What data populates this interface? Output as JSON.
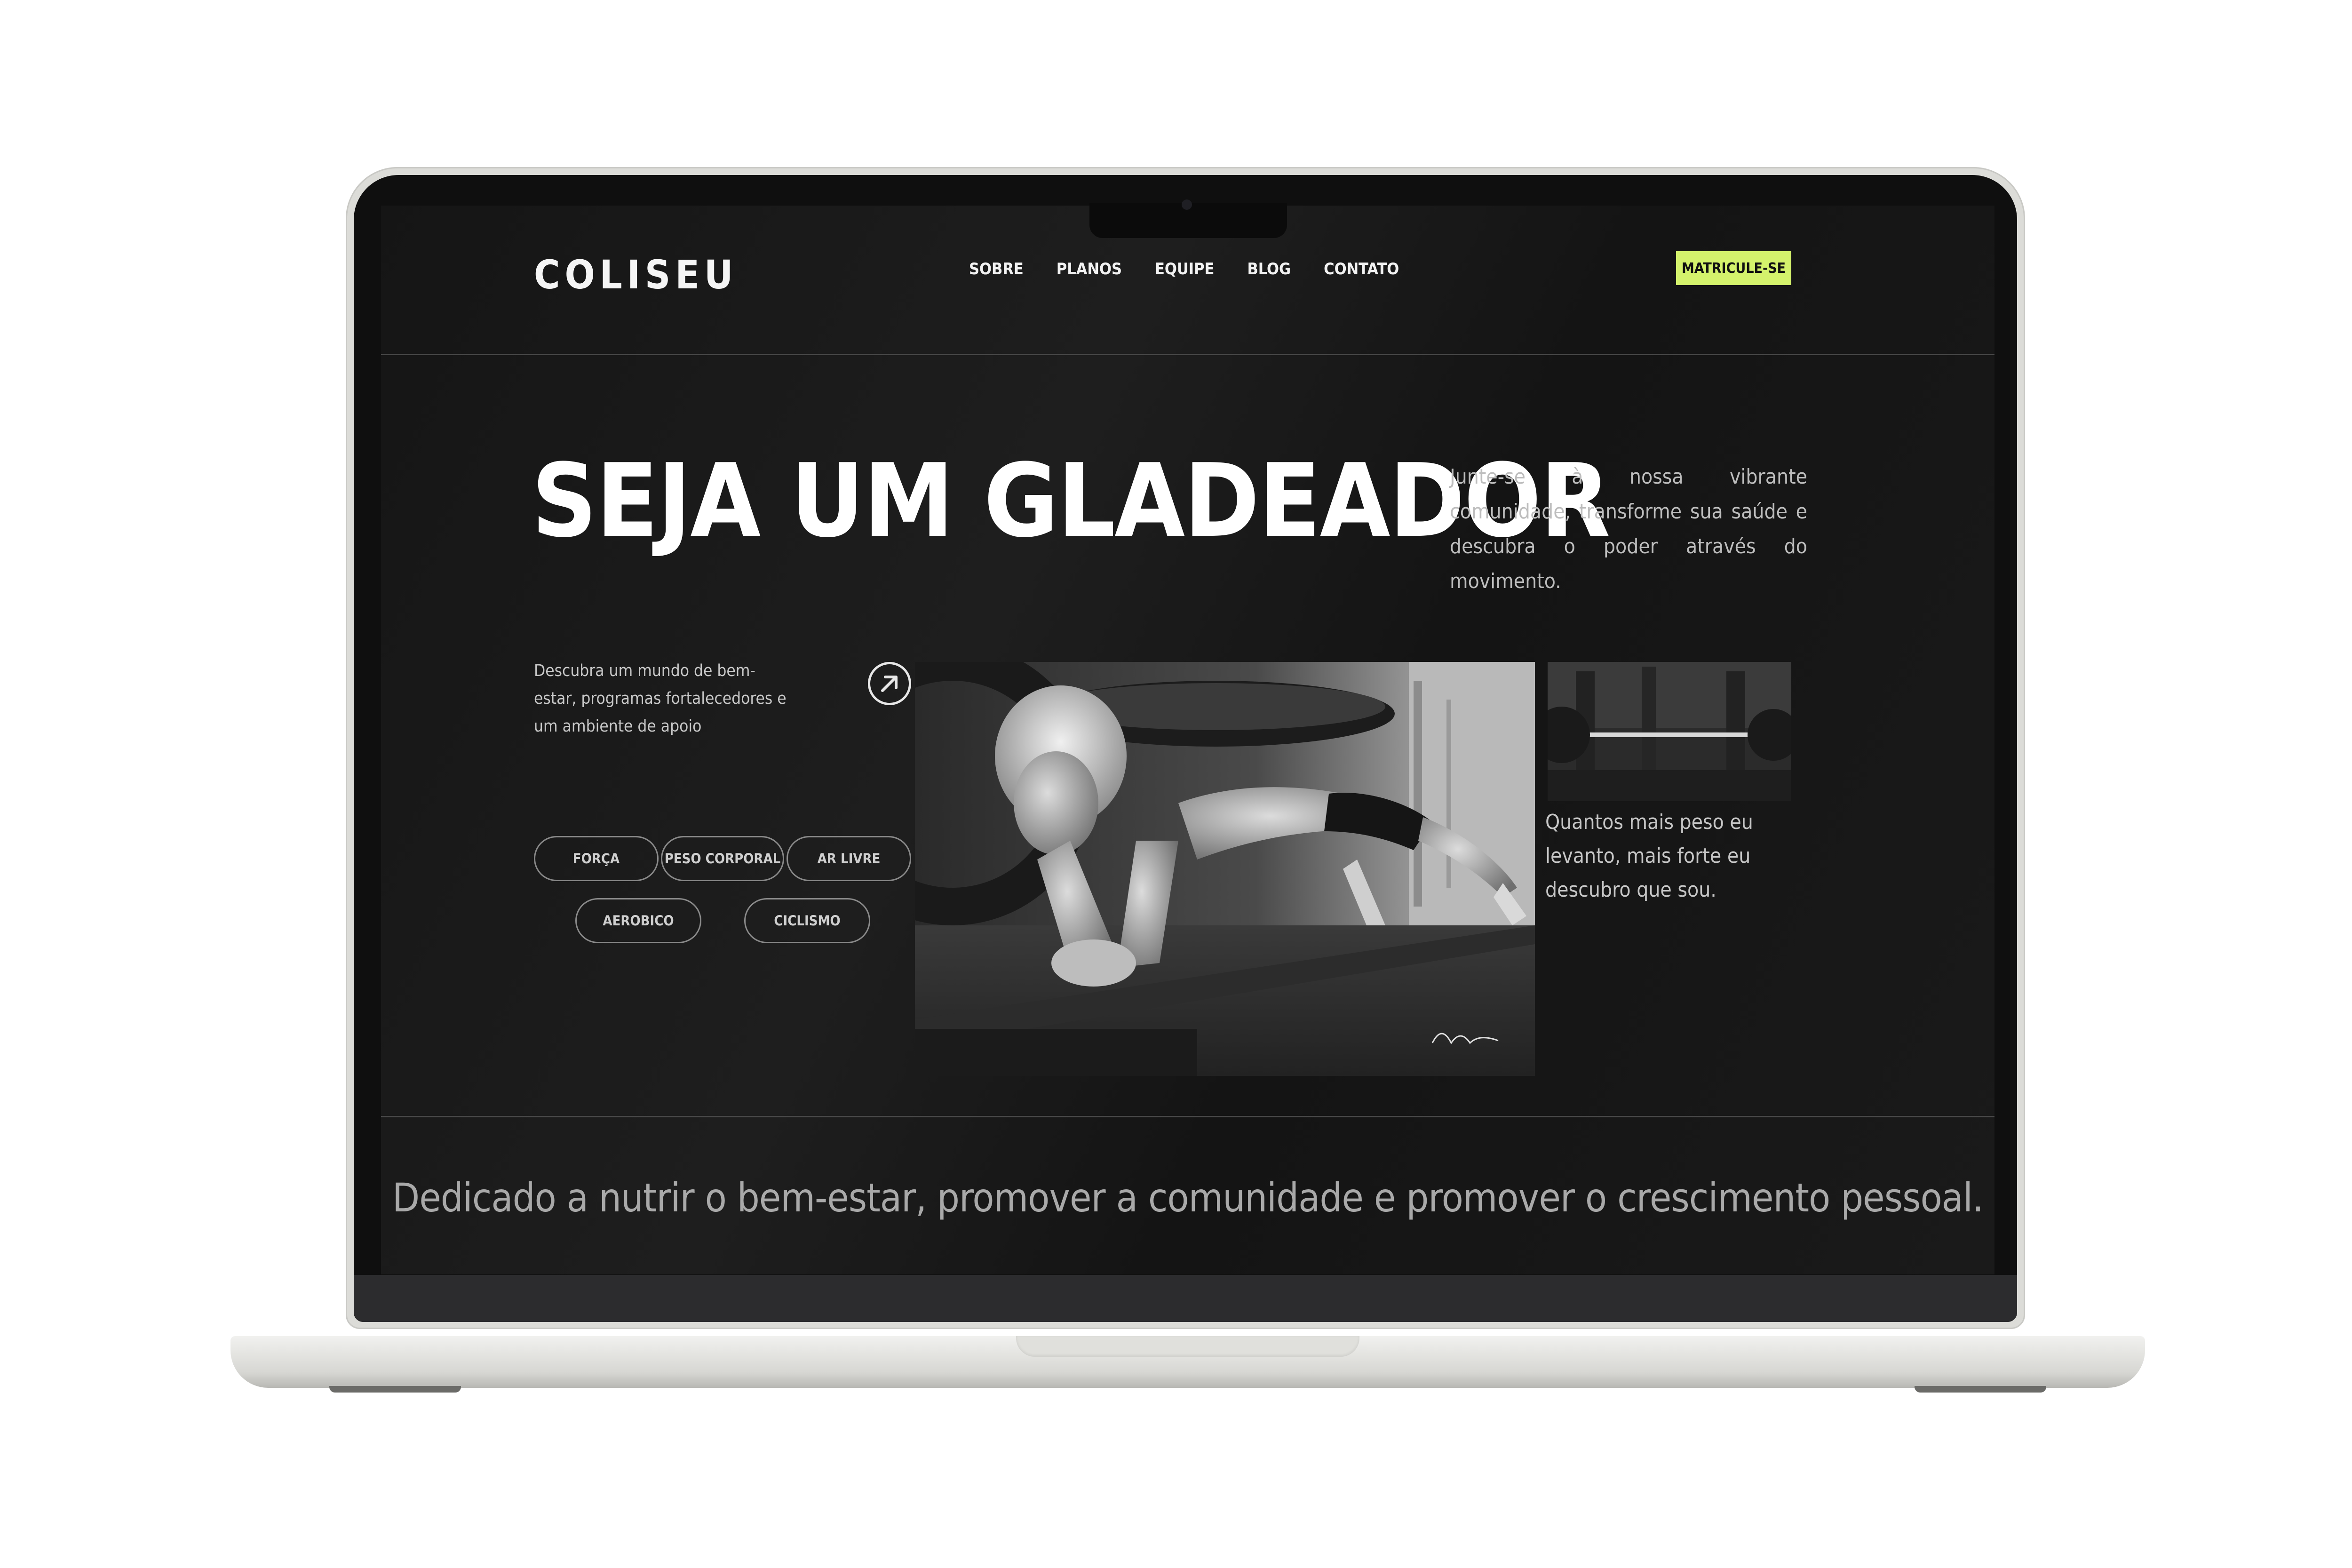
{
  "header": {
    "logo": "COLISEU",
    "nav": [
      "SOBRE",
      "PLANOS",
      "EQUIPE",
      "BLOG",
      "CONTATO"
    ],
    "cta_label": "MATRICULE-SE"
  },
  "hero": {
    "title": "SEJA UM GLADEADOR",
    "subtitle": "Junte-se à nossa vibrante comunidade, transforme sua saúde e descubra o poder através do movimento.",
    "intro": "Descubra um mundo de bem-estar, programas fortalecedores e um ambiente de apoio",
    "tags": [
      "FORÇA",
      "PESO CORPORAL",
      "AR LIVRE",
      "AEROBICO",
      "CICLISMO"
    ],
    "quote": "Quantos mais peso eu levanto, mais forte eu descubro que sou.",
    "arrow_icon": "arrow-up-right-icon"
  },
  "mission": {
    "text": "Dedicado a nutrir o bem-estar, promover a comunidade e promover o crescimento pessoal."
  },
  "colors": {
    "background": "#151515",
    "accent": "#d4f26c",
    "text": "#ffffff",
    "muted_text": "#bdbdbd"
  }
}
